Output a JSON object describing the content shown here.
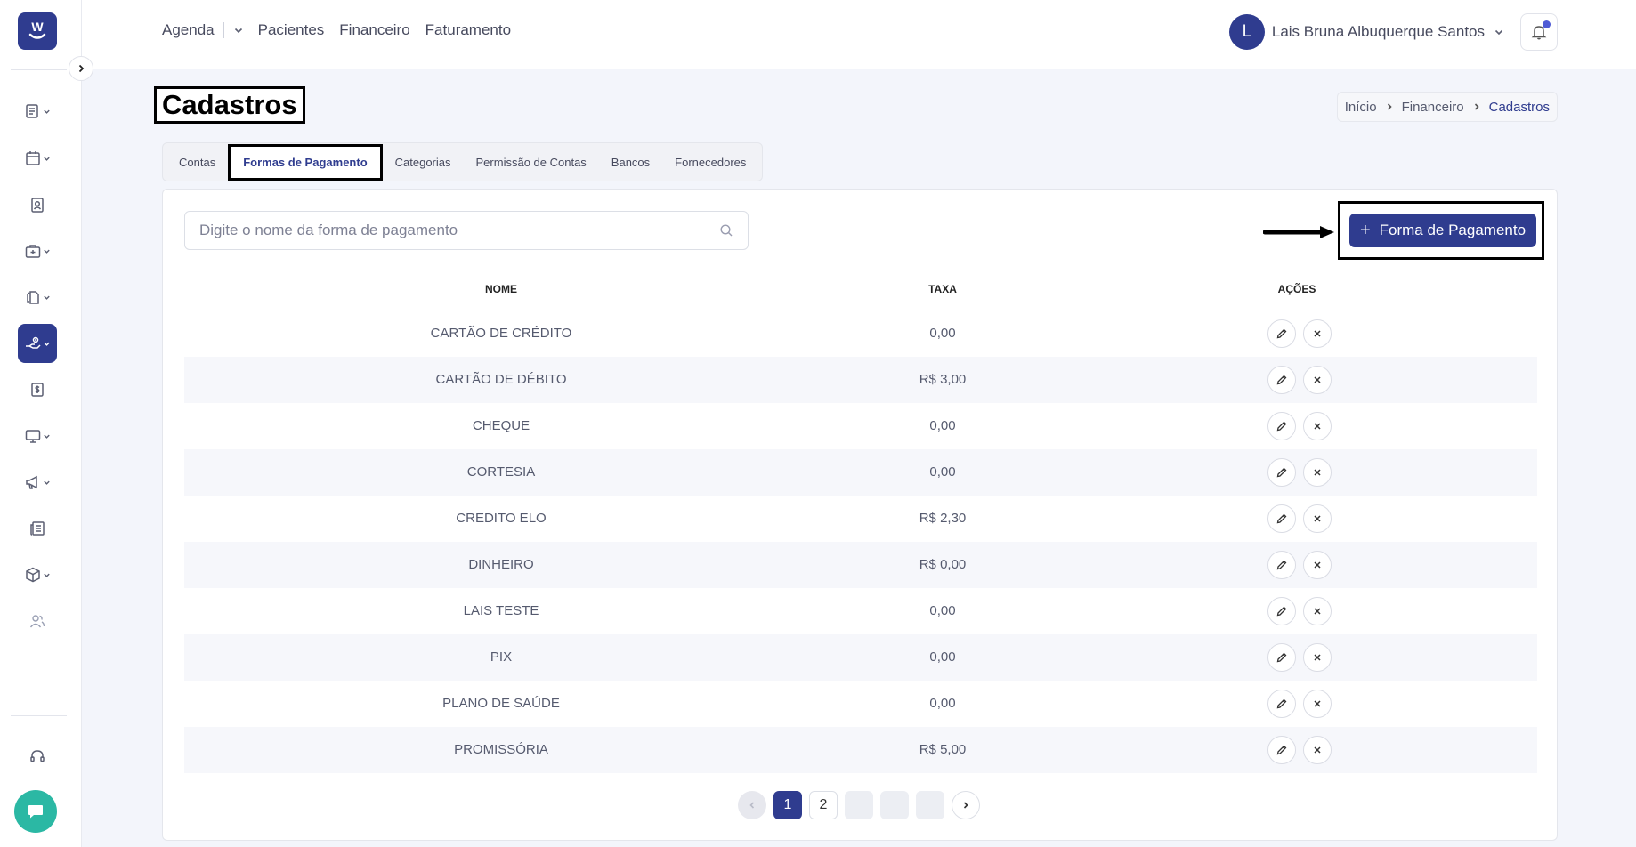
{
  "topnav": {
    "items": [
      "Agenda",
      "Pacientes",
      "Financeiro",
      "Faturamento"
    ]
  },
  "user": {
    "initial": "L",
    "name": "Lais Bruna Albuquerque Santos"
  },
  "page": {
    "title": "Cadastros"
  },
  "breadcrumb": [
    "Início",
    "Financeiro",
    "Cadastros"
  ],
  "tabs": [
    "Contas",
    "Formas de Pagamento",
    "Categorias",
    "Permissão de Contas",
    "Bancos",
    "Fornecedores"
  ],
  "active_tab": "Formas de Pagamento",
  "search": {
    "placeholder": "Digite o nome da forma de pagamento"
  },
  "add_button": {
    "label": "Forma de Pagamento"
  },
  "table": {
    "headers": [
      "NOME",
      "TAXA",
      "AÇÕES"
    ],
    "rows": [
      {
        "name": "CARTÃO DE CRÉDITO",
        "tax": "0,00"
      },
      {
        "name": "CARTÃO DE DÉBITO",
        "tax": "R$ 3,00"
      },
      {
        "name": "CHEQUE",
        "tax": "0,00"
      },
      {
        "name": "CORTESIA",
        "tax": "0,00"
      },
      {
        "name": "CREDITO ELO",
        "tax": "R$ 2,30"
      },
      {
        "name": "DINHEIRO",
        "tax": "R$ 0,00"
      },
      {
        "name": "LAIS TESTE",
        "tax": "0,00"
      },
      {
        "name": "PIX",
        "tax": "0,00"
      },
      {
        "name": "PLANO DE SAÚDE",
        "tax": "0,00"
      },
      {
        "name": "PROMISSÓRIA",
        "tax": "R$ 5,00"
      }
    ]
  },
  "pagination": {
    "current": "1",
    "pages": [
      "1",
      "2"
    ]
  },
  "colors": {
    "primary": "#2f3c8f",
    "chat": "#2bb8a4",
    "notification_dot": "#4f5bd5"
  }
}
